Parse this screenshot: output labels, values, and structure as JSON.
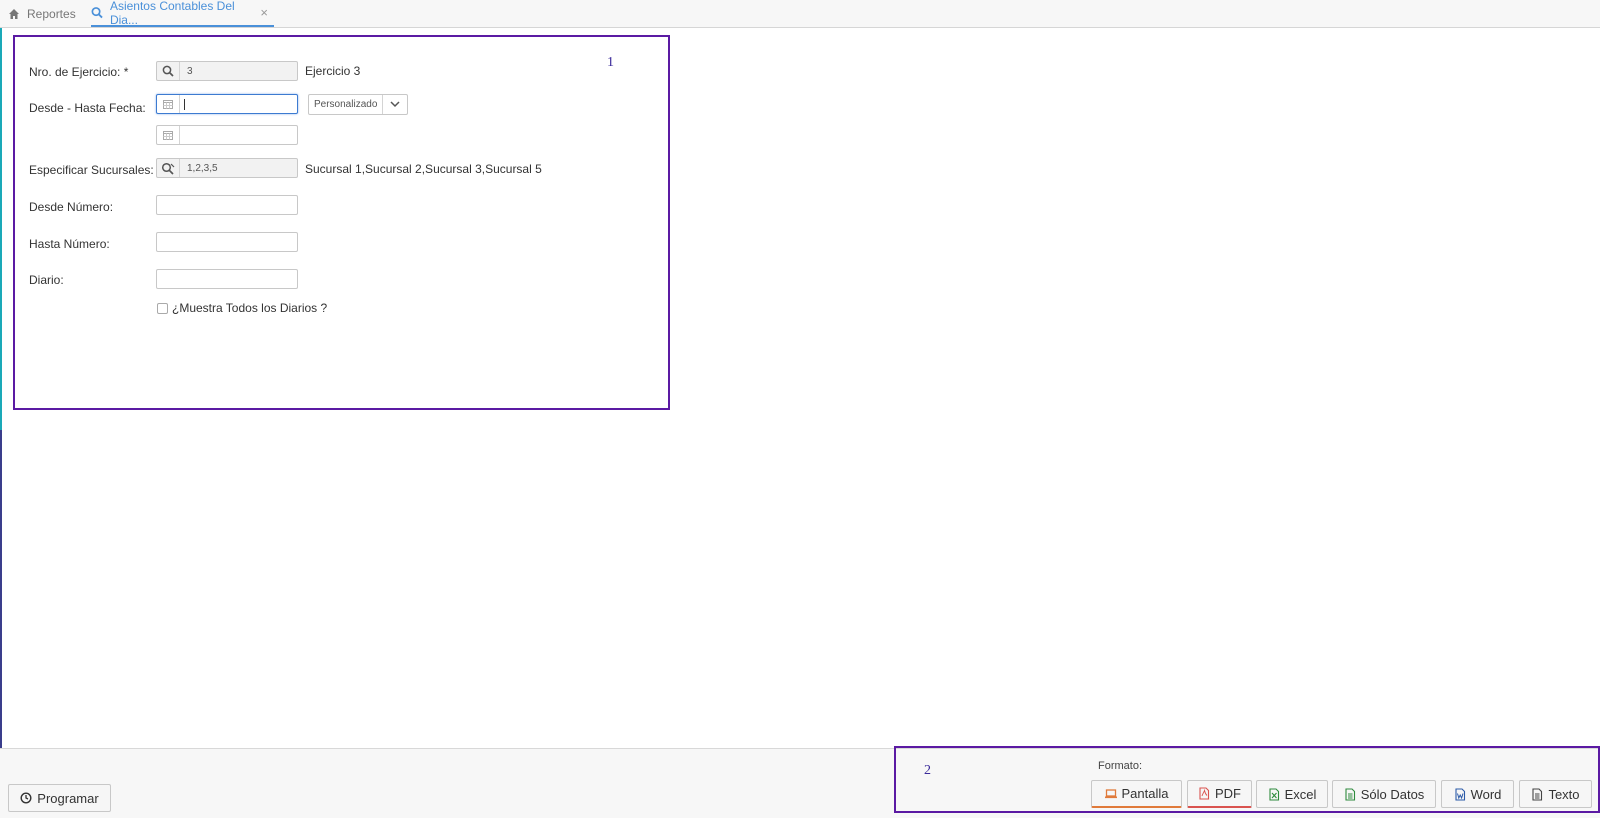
{
  "tabs": [
    {
      "label": "Reportes",
      "icon": "home-icon"
    },
    {
      "label": "Asientos Contables Del Dia...",
      "icon": "search-icon",
      "close": "×"
    }
  ],
  "annotations": {
    "box1": "1",
    "box2": "2"
  },
  "form": {
    "ejercicio": {
      "label": "Nro. de Ejercicio: *",
      "value": "3",
      "desc": "Ejercicio 3"
    },
    "fecha": {
      "label": "Desde - Hasta Fecha:",
      "desde": "",
      "hasta": "",
      "preset": "Personalizado"
    },
    "sucursales": {
      "label": "Especificar Sucursales:",
      "value": "1,2,3,5",
      "desc": "Sucursal 1,Sucursal 2,Sucursal 3,Sucursal 5"
    },
    "desde_numero": {
      "label": "Desde Número:",
      "value": ""
    },
    "hasta_numero": {
      "label": "Hasta Número:",
      "value": ""
    },
    "diario": {
      "label": "Diario:",
      "value": ""
    },
    "todos_diarios": {
      "label": "¿Muestra Todos los Diarios ?",
      "checked": false
    }
  },
  "footer": {
    "programar": "Programar",
    "formato_label": "Formato:",
    "formats": {
      "pantalla": "Pantalla",
      "pdf": "PDF",
      "excel": "Excel",
      "solo_datos": "Sólo Datos",
      "word": "Word",
      "texto": "Texto"
    }
  },
  "colors": {
    "accent": "#4a90d9",
    "annotation": "#5b1aa3"
  }
}
